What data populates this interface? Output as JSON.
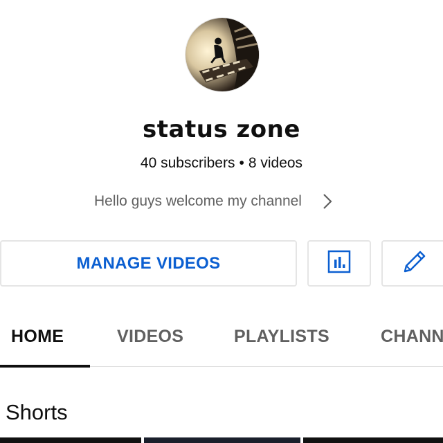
{
  "channel": {
    "name": "status zone",
    "subscribers": "40 subscribers",
    "separator": "•",
    "videos": "8 videos",
    "description": "Hello guys welcome my channel",
    "avatar_icon": "channel-avatar"
  },
  "actions": {
    "manage_videos_label": "MANAGE VIDEOS",
    "analytics_icon": "analytics-icon",
    "edit_icon": "pencil-icon",
    "accent_color": "#0b5fd1"
  },
  "tabs": [
    {
      "label": "HOME",
      "active": true
    },
    {
      "label": "VIDEOS",
      "active": false
    },
    {
      "label": "PLAYLISTS",
      "active": false
    },
    {
      "label": "CHANN",
      "active": false
    }
  ],
  "sections": {
    "shorts_title": "Shorts"
  }
}
